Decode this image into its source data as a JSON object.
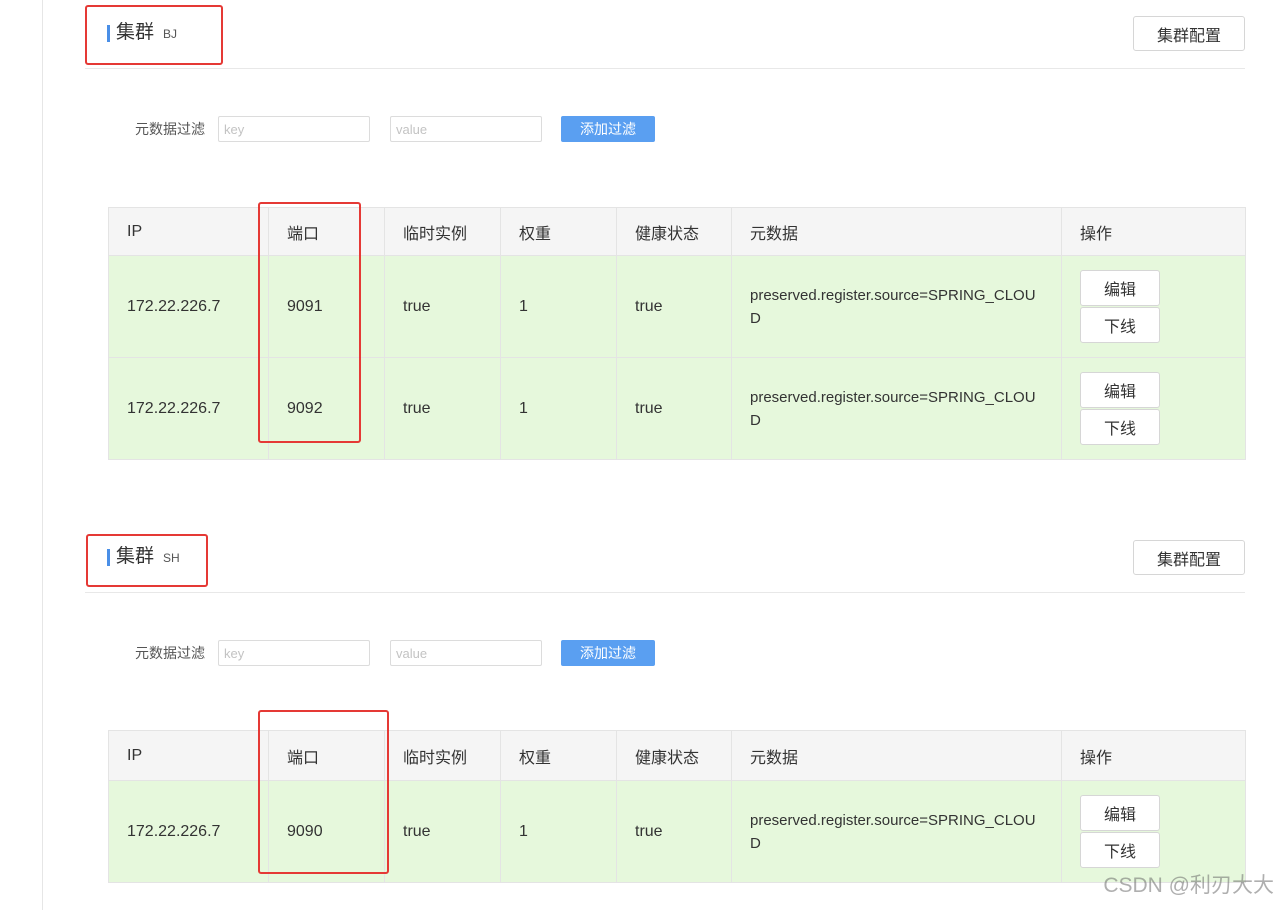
{
  "colors": {
    "accent_bar": "#4a8fe7",
    "primary_button": "#5a9ff1",
    "table_header": "#f5f5f5",
    "healthy_row": "#e6f8dc",
    "annotation": "#e53935"
  },
  "clusters": [
    {
      "title": "集群",
      "name": "BJ",
      "config_button": "集群配置",
      "filter": {
        "label": "元数据过滤",
        "key_placeholder": "key",
        "value_placeholder": "value",
        "add_button": "添加过滤"
      },
      "columns": [
        "IP",
        "端口",
        "临时实例",
        "权重",
        "健康状态",
        "元数据",
        "操作"
      ],
      "instances": [
        {
          "ip": "172.22.226.7",
          "port": "9091",
          "ephemeral": "true",
          "weight": "1",
          "healthy": "true",
          "metadata": "preserved.register.source=SPRING_CLOUD",
          "edit": "编辑",
          "offline": "下线"
        },
        {
          "ip": "172.22.226.7",
          "port": "9092",
          "ephemeral": "true",
          "weight": "1",
          "healthy": "true",
          "metadata": "preserved.register.source=SPRING_CLOUD",
          "edit": "编辑",
          "offline": "下线"
        }
      ]
    },
    {
      "title": "集群",
      "name": "SH",
      "config_button": "集群配置",
      "filter": {
        "label": "元数据过滤",
        "key_placeholder": "key",
        "value_placeholder": "value",
        "add_button": "添加过滤"
      },
      "columns": [
        "IP",
        "端口",
        "临时实例",
        "权重",
        "健康状态",
        "元数据",
        "操作"
      ],
      "instances": [
        {
          "ip": "172.22.226.7",
          "port": "9090",
          "ephemeral": "true",
          "weight": "1",
          "healthy": "true",
          "metadata": "preserved.register.source=SPRING_CLOUD",
          "edit": "编辑",
          "offline": "下线"
        }
      ]
    }
  ],
  "watermark": "CSDN @利刃大大"
}
